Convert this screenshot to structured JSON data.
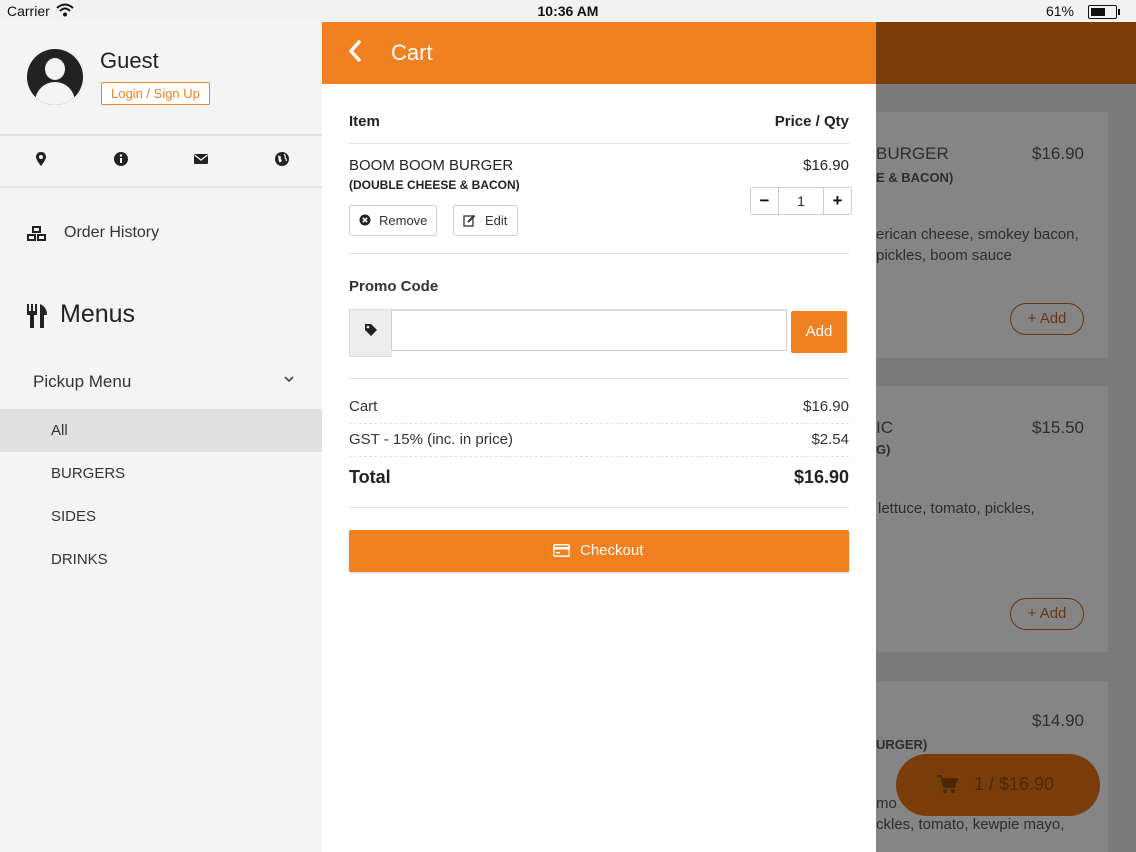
{
  "status_bar": {
    "carrier": "Carrier",
    "time": "10:36 AM",
    "battery_percent": "61%",
    "battery_level": 0.61
  },
  "sidebar": {
    "user_name": "Guest",
    "login_label": "Login / Sign Up",
    "quick_icons": [
      "location-icon",
      "info-icon",
      "mail-icon",
      "globe-icon"
    ],
    "order_history_label": "Order History",
    "menus_heading": "Menus",
    "pickup_menu_label": "Pickup Menu",
    "categories": [
      {
        "label": "All",
        "active": true
      },
      {
        "label": "BURGERS",
        "active": false
      },
      {
        "label": "SIDES",
        "active": false
      },
      {
        "label": "DRINKS",
        "active": false
      }
    ]
  },
  "background_menu": {
    "cards": [
      {
        "title": "BURGER",
        "price": "$16.90",
        "subtitle": "E & BACON)",
        "desc1": "erican cheese, smokey bacon,",
        "desc2": "pickles, boom sauce",
        "add_label": "Add"
      },
      {
        "title": "IC",
        "price": "$15.50",
        "subtitle": "G)",
        "desc1": "lettuce, tomato, pickles,",
        "desc2": "",
        "add_label": "Add"
      },
      {
        "title": "",
        "price": "$14.90",
        "subtitle": "URGER)",
        "desc1": "mo",
        "desc2": "ckles, tomato, kewpie mayo,",
        "add_label": ""
      }
    ],
    "cart_fab_label": "1 / $16.90"
  },
  "cart": {
    "title": "Cart",
    "col_item": "Item",
    "col_price_qty": "Price / Qty",
    "items": [
      {
        "name": "BOOM BOOM BURGER",
        "modifier": "(DOUBLE CHEESE & BACON)",
        "price": "$16.90",
        "qty": "1",
        "remove_label": "Remove",
        "edit_label": "Edit"
      }
    ],
    "promo": {
      "label": "Promo Code",
      "value": "",
      "placeholder": "",
      "add_label": "Add"
    },
    "summary": {
      "cart_label": "Cart",
      "cart_value": "$16.90",
      "gst_label": "GST - 15% (inc. in price)",
      "gst_value": "$2.54",
      "total_label": "Total",
      "total_value": "$16.90"
    },
    "checkout_label": "Checkout"
  },
  "colors": {
    "accent": "#f08020",
    "sidebar_bg": "#f4f4f4",
    "active_item_bg": "#e0e0e0"
  }
}
